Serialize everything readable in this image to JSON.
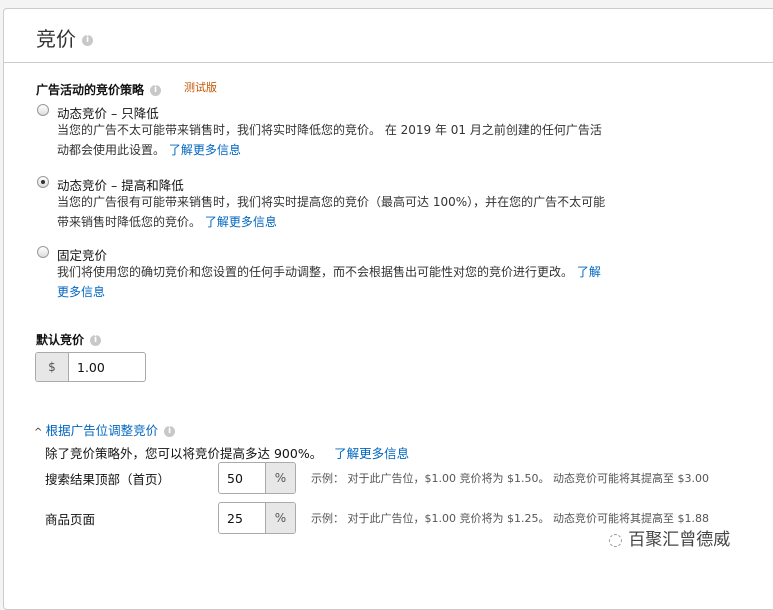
{
  "header": {
    "title": "竞价"
  },
  "strategy": {
    "label": "广告活动的竞价策略",
    "badge": "测试版",
    "options": [
      {
        "label": "动态竞价 – 只降低",
        "desc": "当您的广告不太可能带来销售时，我们将实时降低您的竞价。 在 2019 年 01 月之前创建的任何广告活动都会使用此设置。",
        "link": "了解更多信息",
        "selected": false
      },
      {
        "label": "动态竞价 – 提高和降低",
        "desc": "当您的广告很有可能带来销售时，我们将实时提高您的竞价（最高可达 100%），并在您的广告不太可能带来销售时降低您的竞价。",
        "link": "了解更多信息",
        "selected": true
      },
      {
        "label": "固定竞价",
        "desc": "我们将使用您的确切竞价和您设置的任何手动调整，而不会根据售出可能性对您的竞价进行更改。",
        "link": "了解更多信息",
        "selected": false
      }
    ]
  },
  "default_bid": {
    "label": "默认竞价",
    "currency": "$",
    "value": "1.00"
  },
  "placement": {
    "toggle": "根据广告位调整竞价",
    "intro": "除了竞价策略外，您可以将竞价提高多达 900%。",
    "link": "了解更多信息",
    "rows": [
      {
        "label": "搜索结果顶部（首页）",
        "value": "50",
        "unit": "%",
        "example": "示例： 对于此广告位，$1.00 竞价将为 $1.50。 动态竞价可能将其提高至 $3.00"
      },
      {
        "label": "商品页面",
        "value": "25",
        "unit": "%",
        "example": "示例： 对于此广告位，$1.00 竞价将为 $1.25。 动态竞价可能将其提高至 $1.88"
      }
    ]
  },
  "watermark": "百聚汇曾德威"
}
